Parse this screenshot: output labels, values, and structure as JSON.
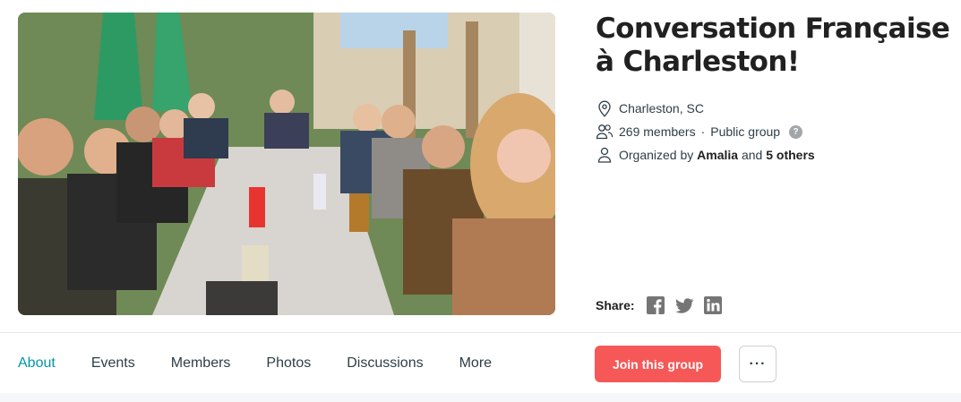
{
  "group": {
    "title": "Conversation Française à Charleston!",
    "location": "Charleston, SC",
    "members": "269 members",
    "separator": "·",
    "visibility": "Public group",
    "help_badge": "?",
    "organized_prefix": "Organized by",
    "organizer": "Amalia",
    "organized_and": "and",
    "others": "5 others"
  },
  "share": {
    "label": "Share:",
    "icons": [
      "facebook-icon",
      "twitter-icon",
      "linkedin-icon"
    ]
  },
  "tabs": [
    {
      "label": "About",
      "active": true
    },
    {
      "label": "Events",
      "active": false
    },
    {
      "label": "Members",
      "active": false
    },
    {
      "label": "Photos",
      "active": false
    },
    {
      "label": "Discussions",
      "active": false
    },
    {
      "label": "More",
      "active": false
    }
  ],
  "actions": {
    "join_label": "Join this group",
    "more_label": "···"
  },
  "colors": {
    "accent_teal": "#0098ab",
    "join_red": "#f65858",
    "icon_gray": "#757575"
  }
}
